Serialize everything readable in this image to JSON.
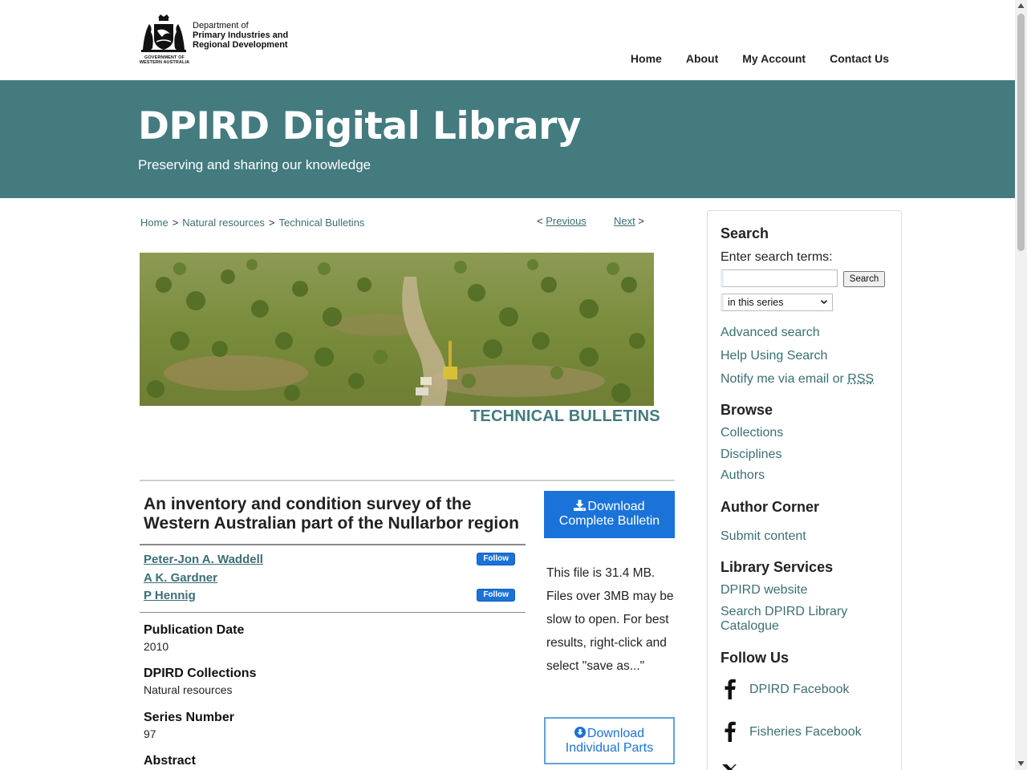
{
  "brand": {
    "dept_line1": "Department of",
    "dept_line2": "Primary Industries and",
    "dept_line3": "Regional Development",
    "gov_line1": "GOVERNMENT OF",
    "gov_line2": "WESTERN AUSTRALIA"
  },
  "nav": {
    "items": [
      {
        "label": "Home"
      },
      {
        "label": "About"
      },
      {
        "label": "My Account"
      },
      {
        "label": "Contact Us"
      }
    ]
  },
  "banner": {
    "title": "DPIRD Digital Library",
    "subtitle": "Preserving and sharing our knowledge",
    "color": "#437b7f"
  },
  "breadcrumb": {
    "items": [
      {
        "label": "Home"
      },
      {
        "label": "Natural resources"
      },
      {
        "label": "Technical Bulletins"
      }
    ],
    "separator": ">"
  },
  "pager": {
    "prev_arrow": "<",
    "prev_label": "Previous",
    "next_label": "Next",
    "next_arrow": ">"
  },
  "series": {
    "caption": "TECHNICAL BULLETINS"
  },
  "article": {
    "title": "An inventory and condition survey of the Western Australian part of the Nullarbor region",
    "authors": [
      {
        "name": "Peter-Jon A. Waddell",
        "follow": "Follow"
      },
      {
        "name": "A K. Gardner",
        "follow": ""
      },
      {
        "name": "P Hennig",
        "follow": "Follow"
      }
    ],
    "meta": [
      {
        "label": "Publication Date",
        "value": "2010"
      },
      {
        "label": "DPIRD Collections",
        "value": "Natural resources"
      },
      {
        "label": "Series Number",
        "value": "97"
      },
      {
        "label": "Abstract",
        "value": ""
      }
    ]
  },
  "download": {
    "complete_line1": "Download",
    "complete_line2": "Complete Bulletin",
    "note": "This file is 31.4 MB. Files over 3MB may be slow to open. For best results, right-click and select \"save as...\"",
    "parts_line1": "Download",
    "parts_line2": "Individual Parts",
    "accent": "#1a73d9"
  },
  "sidebar": {
    "search_heading": "Search",
    "search_prompt": "Enter search terms:",
    "search_value": "",
    "search_button": "Search",
    "scope_selected": "in this series",
    "advanced_search": "Advanced search",
    "help_search": "Help Using Search",
    "notify_prefix": "Notify me via email or ",
    "notify_rss": "RSS",
    "browse_heading": "Browse",
    "browse_items": [
      "Collections",
      "Disciplines",
      "Authors"
    ],
    "author_heading": "Author Corner",
    "submit_content": "Submit content",
    "services_heading": "Library Services",
    "dpird_website": "DPIRD website",
    "catalogue_line1": "Search DPIRD Library",
    "catalogue_line2": "Catalogue",
    "follow_heading": "Follow Us",
    "social": [
      {
        "label": "DPIRD Facebook",
        "icon": "facebook-icon"
      },
      {
        "label": "Fisheries Facebook",
        "icon": "facebook-icon"
      }
    ]
  }
}
